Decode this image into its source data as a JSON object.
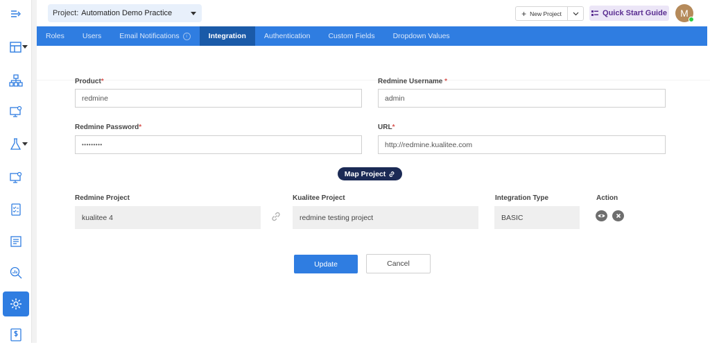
{
  "header": {
    "project_prefix": "Project:",
    "project_name": "Automation Demo Practice",
    "new_project_label": "New Project",
    "quick_start_label": "Quick Start Guide",
    "avatar_initial": "M"
  },
  "tabs": [
    {
      "label": "Roles",
      "active": false
    },
    {
      "label": "Users",
      "active": false
    },
    {
      "label": "Email Notifications",
      "active": false,
      "info_icon": true
    },
    {
      "label": "Integration",
      "active": true
    },
    {
      "label": "Authentication",
      "active": false
    },
    {
      "label": "Custom Fields",
      "active": false
    },
    {
      "label": "Dropdown Values",
      "active": false
    }
  ],
  "form": {
    "product_label": "Product",
    "product_value": "redmine",
    "username_label": "Redmine Username ",
    "username_value": "admin",
    "password_label": "Redmine Password",
    "password_value": "•••••••••",
    "url_label": "URL",
    "url_value": "http://redmine.kualitee.com",
    "required_mark": "*",
    "map_project_label": "Map Project"
  },
  "mapping": {
    "headers": {
      "redmine_project": "Redmine Project",
      "kualitee_project": "Kualitee Project",
      "integration_type": "Integration Type",
      "action": "Action"
    },
    "row": {
      "redmine_project": "kualitee 4",
      "kualitee_project": "redmine testing project",
      "integration_type": "BASIC"
    }
  },
  "buttons": {
    "update": "Update",
    "cancel": "Cancel"
  },
  "sidebar": {
    "icons": [
      "collapse-menu-icon",
      "layout-icon",
      "hierarchy-icon",
      "monitor-settings-icon",
      "flask-icon",
      "monitor-settings-icon",
      "checklist-icon",
      "report-icon",
      "analytics-search-icon",
      "gear-icon",
      "dollar-doc-icon"
    ]
  },
  "colors": {
    "accent": "#2f7de1",
    "tab_active": "#1a5aa8",
    "map_button": "#1b2a55",
    "quick_start_bg": "#ece6f7",
    "quick_start_text": "#5a2d91",
    "required": "#d9534f"
  }
}
